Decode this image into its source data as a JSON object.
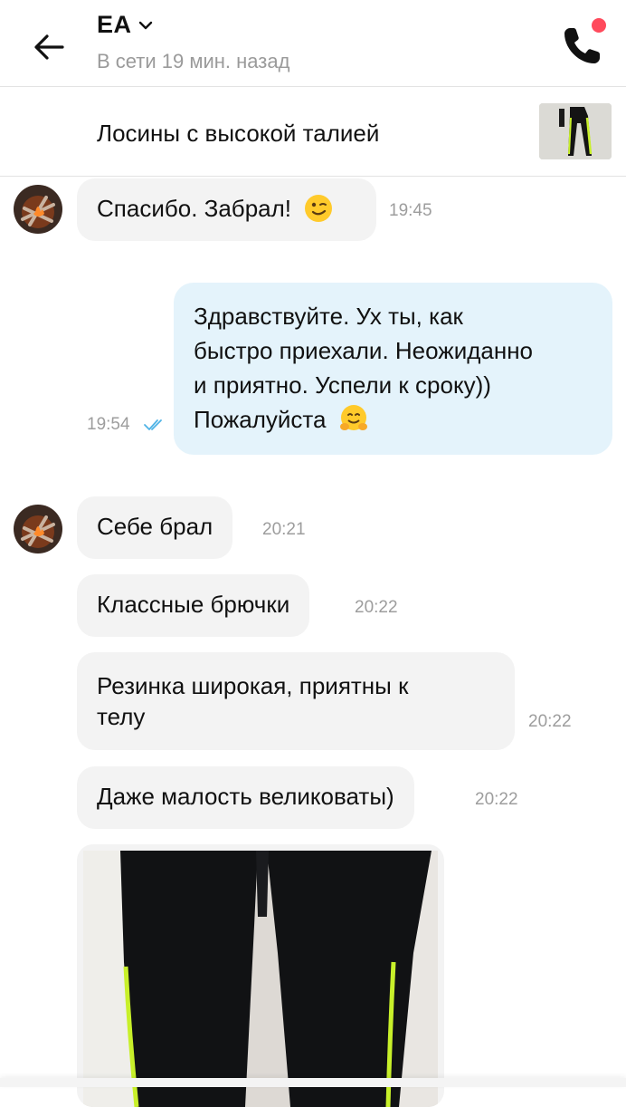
{
  "header": {
    "contact_name": "EA",
    "status": "В сети 19 мин. назад"
  },
  "product": {
    "title": "Лосины с высокой талией"
  },
  "messages": [
    {
      "direction": "incoming",
      "text": "Спасибо. Забрал!",
      "emoji": "winking-face",
      "time": "19:45"
    },
    {
      "direction": "outgoing",
      "lines": [
        "Здравствуйте. Ух ты, как",
        "быстро приехали. Неожиданно",
        "и приятно. Успели к сроку))",
        "Пожалуйста"
      ],
      "emoji": "hugging-face",
      "time": "19:54",
      "status": "read"
    },
    {
      "direction": "incoming",
      "text": "Себе брал",
      "time": "20:21"
    },
    {
      "direction": "incoming",
      "text": "Классные брючки",
      "time": "20:22"
    },
    {
      "direction": "incoming",
      "lines": [
        "Резинка широкая, приятны к",
        "телу"
      ],
      "time": "20:22"
    },
    {
      "direction": "incoming",
      "text": "Даже малость великоваты)",
      "time": "20:22"
    },
    {
      "direction": "incoming",
      "type": "photo",
      "photo": "leggings-photo"
    }
  ],
  "colors": {
    "outgoing_bubble": "#e4f3fb",
    "incoming_bubble": "#f3f3f3",
    "online_dot": "#ff4a5c",
    "read_ticks": "#4fb3e6",
    "leggings_stripe": "#c8f02a"
  }
}
